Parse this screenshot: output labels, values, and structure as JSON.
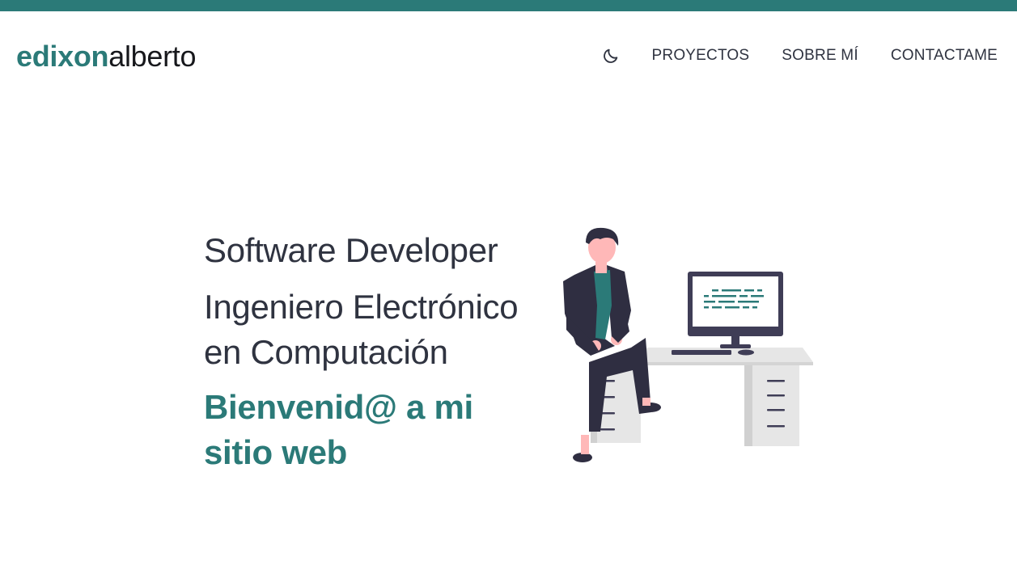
{
  "colors": {
    "accent": "#2b7a78",
    "text_dark": "#2f3340",
    "top_bar": "#2b7a78"
  },
  "header": {
    "logo_first": "edixon",
    "logo_second": "alberto",
    "theme_icon": "moon-icon",
    "nav": [
      {
        "label": "PROYECTOS"
      },
      {
        "label": "SOBRE MÍ"
      },
      {
        "label": "CONTACTAME"
      }
    ]
  },
  "hero": {
    "role_1": "Software Developer",
    "role_2": "Ingeniero Electrónico en Computación",
    "welcome": "Bienvenid@ a mi sitio web",
    "illustration": "developer-at-desk-illustration"
  }
}
